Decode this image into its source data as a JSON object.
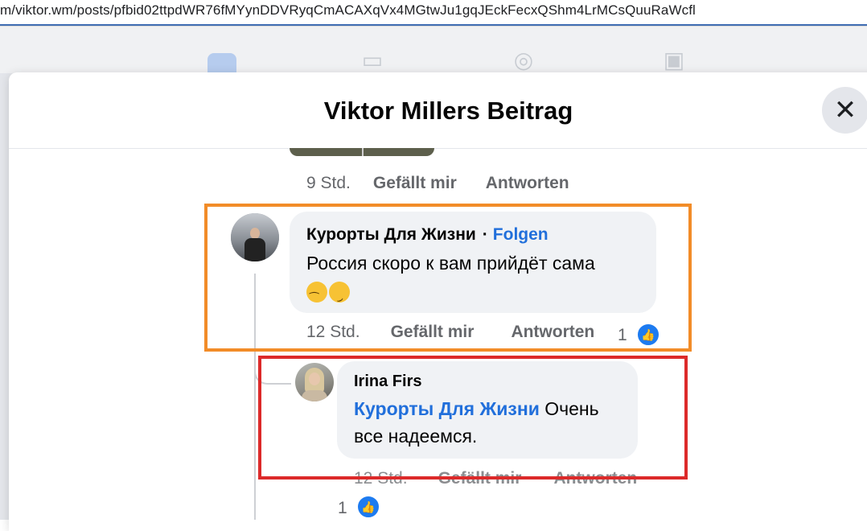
{
  "browser": {
    "url": "m/viktor.wm/posts/pfbid02ttpdWR76fMYynDDVRyqCmACAXqVx4MGtwJu1gqJEckFecxQShm4LrMCsQuuRaWcfl"
  },
  "modal": {
    "title": "Viktor Millers Beitrag",
    "close_icon": "close-icon"
  },
  "previous_comment": {
    "timestamp": "9 Std.",
    "like_label": "Gefällt mir",
    "reply_label": "Antworten"
  },
  "comment": {
    "author": "Курорты Для Жизни",
    "separator": "·",
    "follow_label": "Folgen",
    "text": "Россия скоро к вам прийдёт сама",
    "timestamp": "12 Std.",
    "like_label": "Gefällt mir",
    "reply_label": "Antworten",
    "like_count": "1"
  },
  "reply": {
    "author": "Irina Firs",
    "mention": "Курорты Для Жизни",
    "text_line1": "Очень",
    "text_line2": "все надеемся.",
    "timestamp": "12 Std.",
    "like_label": "Gefällt mir",
    "reply_label": "Antworten",
    "like_count": "1"
  },
  "colors": {
    "highlight_comment": "#f28c28",
    "highlight_reply": "#dc2a2a",
    "link": "#216fdb"
  }
}
